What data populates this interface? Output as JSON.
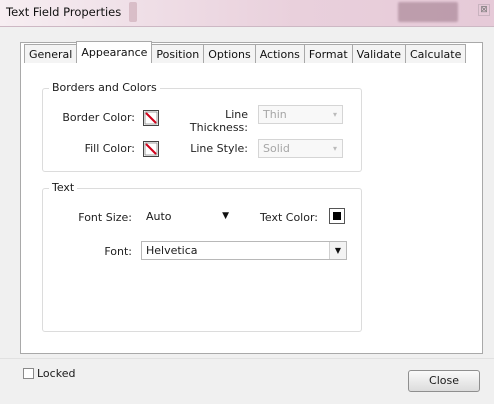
{
  "window": {
    "title": "Text Field Properties",
    "close_glyph": "⊠"
  },
  "tabs": [
    {
      "label": "General"
    },
    {
      "label": "Appearance"
    },
    {
      "label": "Position"
    },
    {
      "label": "Options"
    },
    {
      "label": "Actions"
    },
    {
      "label": "Format"
    },
    {
      "label": "Validate"
    },
    {
      "label": "Calculate"
    }
  ],
  "active_tab": "Appearance",
  "borders_colors": {
    "title": "Borders and Colors",
    "border_color_label": "Border Color:",
    "fill_color_label": "Fill Color:",
    "line_thickness_label": "Line Thickness:",
    "line_thickness_value": "Thin",
    "line_style_label": "Line Style:",
    "line_style_value": "Solid",
    "swatch_icon": "no-color-swatch-icon"
  },
  "text_group": {
    "title": "Text",
    "font_size_label": "Font Size:",
    "font_size_value": "Auto",
    "text_color_label": "Text Color:",
    "text_color": "#000000",
    "font_label": "Font:",
    "font_value": "Helvetica"
  },
  "footer": {
    "locked_label": "Locked",
    "locked_checked": false,
    "close_label": "Close"
  },
  "colors": {
    "no_color_stroke": "#d0021b"
  }
}
